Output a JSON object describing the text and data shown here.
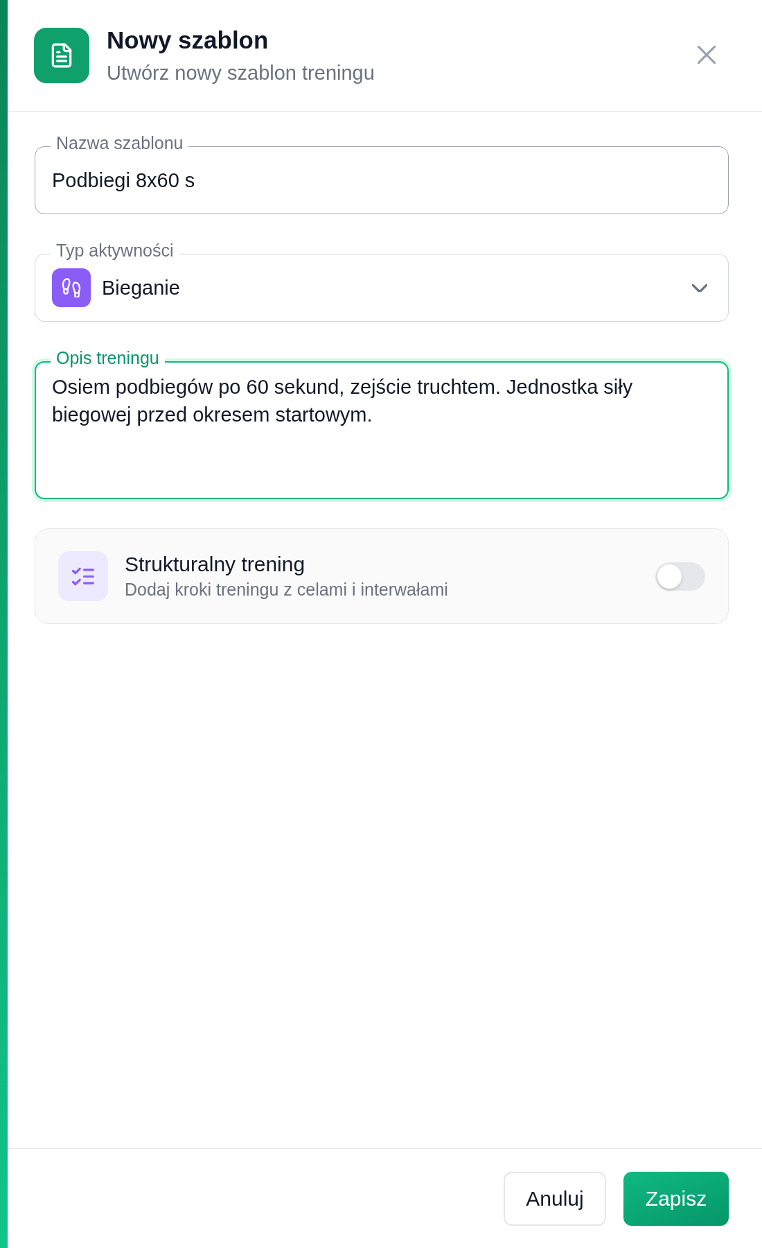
{
  "header": {
    "title": "Nowy szablon",
    "subtitle": "Utwórz nowy szablon treningu"
  },
  "fields": [
    {
      "kind": "text",
      "label": "Nazwa szablonu",
      "value": "Podbiegi 8x60 s",
      "focused": false
    },
    {
      "kind": "select",
      "label": "Typ aktywności",
      "value": "Bieganie",
      "focused": false
    },
    {
      "kind": "textarea",
      "label": "Opis treningu",
      "value": "Osiem podbiegów po 60 sekund, zejście truchtem. Jednostka siły biegowej przed okresem startowym.",
      "focused": true
    }
  ],
  "structured_option": {
    "title": "Strukturalny trening",
    "description": "Dodaj kroki treningu z celami i interwałami",
    "on": false
  },
  "buttons": [
    {
      "kind": "secondary",
      "label": "Anuluj"
    },
    {
      "kind": "primary",
      "label": "Zapisz"
    }
  ]
}
